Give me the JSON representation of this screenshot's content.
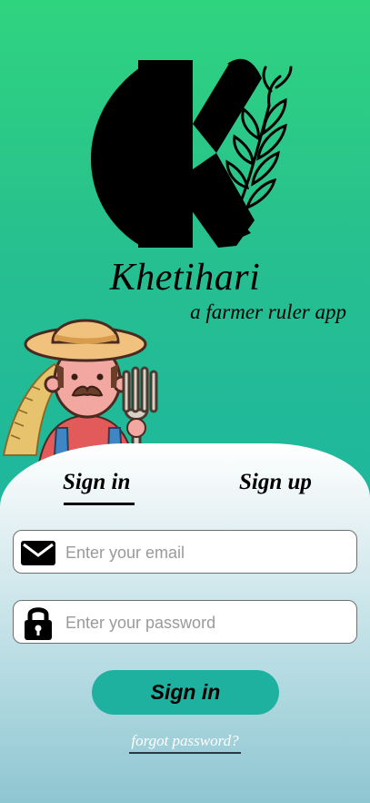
{
  "brand": {
    "name": "Khetihari",
    "tagline": "a farmer ruler app"
  },
  "tabs": {
    "signin_label": "Sign in",
    "signup_label": "Sign up",
    "active": "signin"
  },
  "form": {
    "email_placeholder": "Enter your email",
    "password_placeholder": "Enter your password",
    "email_icon": "mail-icon",
    "password_icon": "lock-icon"
  },
  "actions": {
    "signin_button": "Sign in",
    "forgot_link": "forgot password?"
  },
  "colors": {
    "background_top": "#2fd47f",
    "background_bottom": "#24b7a2",
    "button": "#1eb1a0"
  }
}
